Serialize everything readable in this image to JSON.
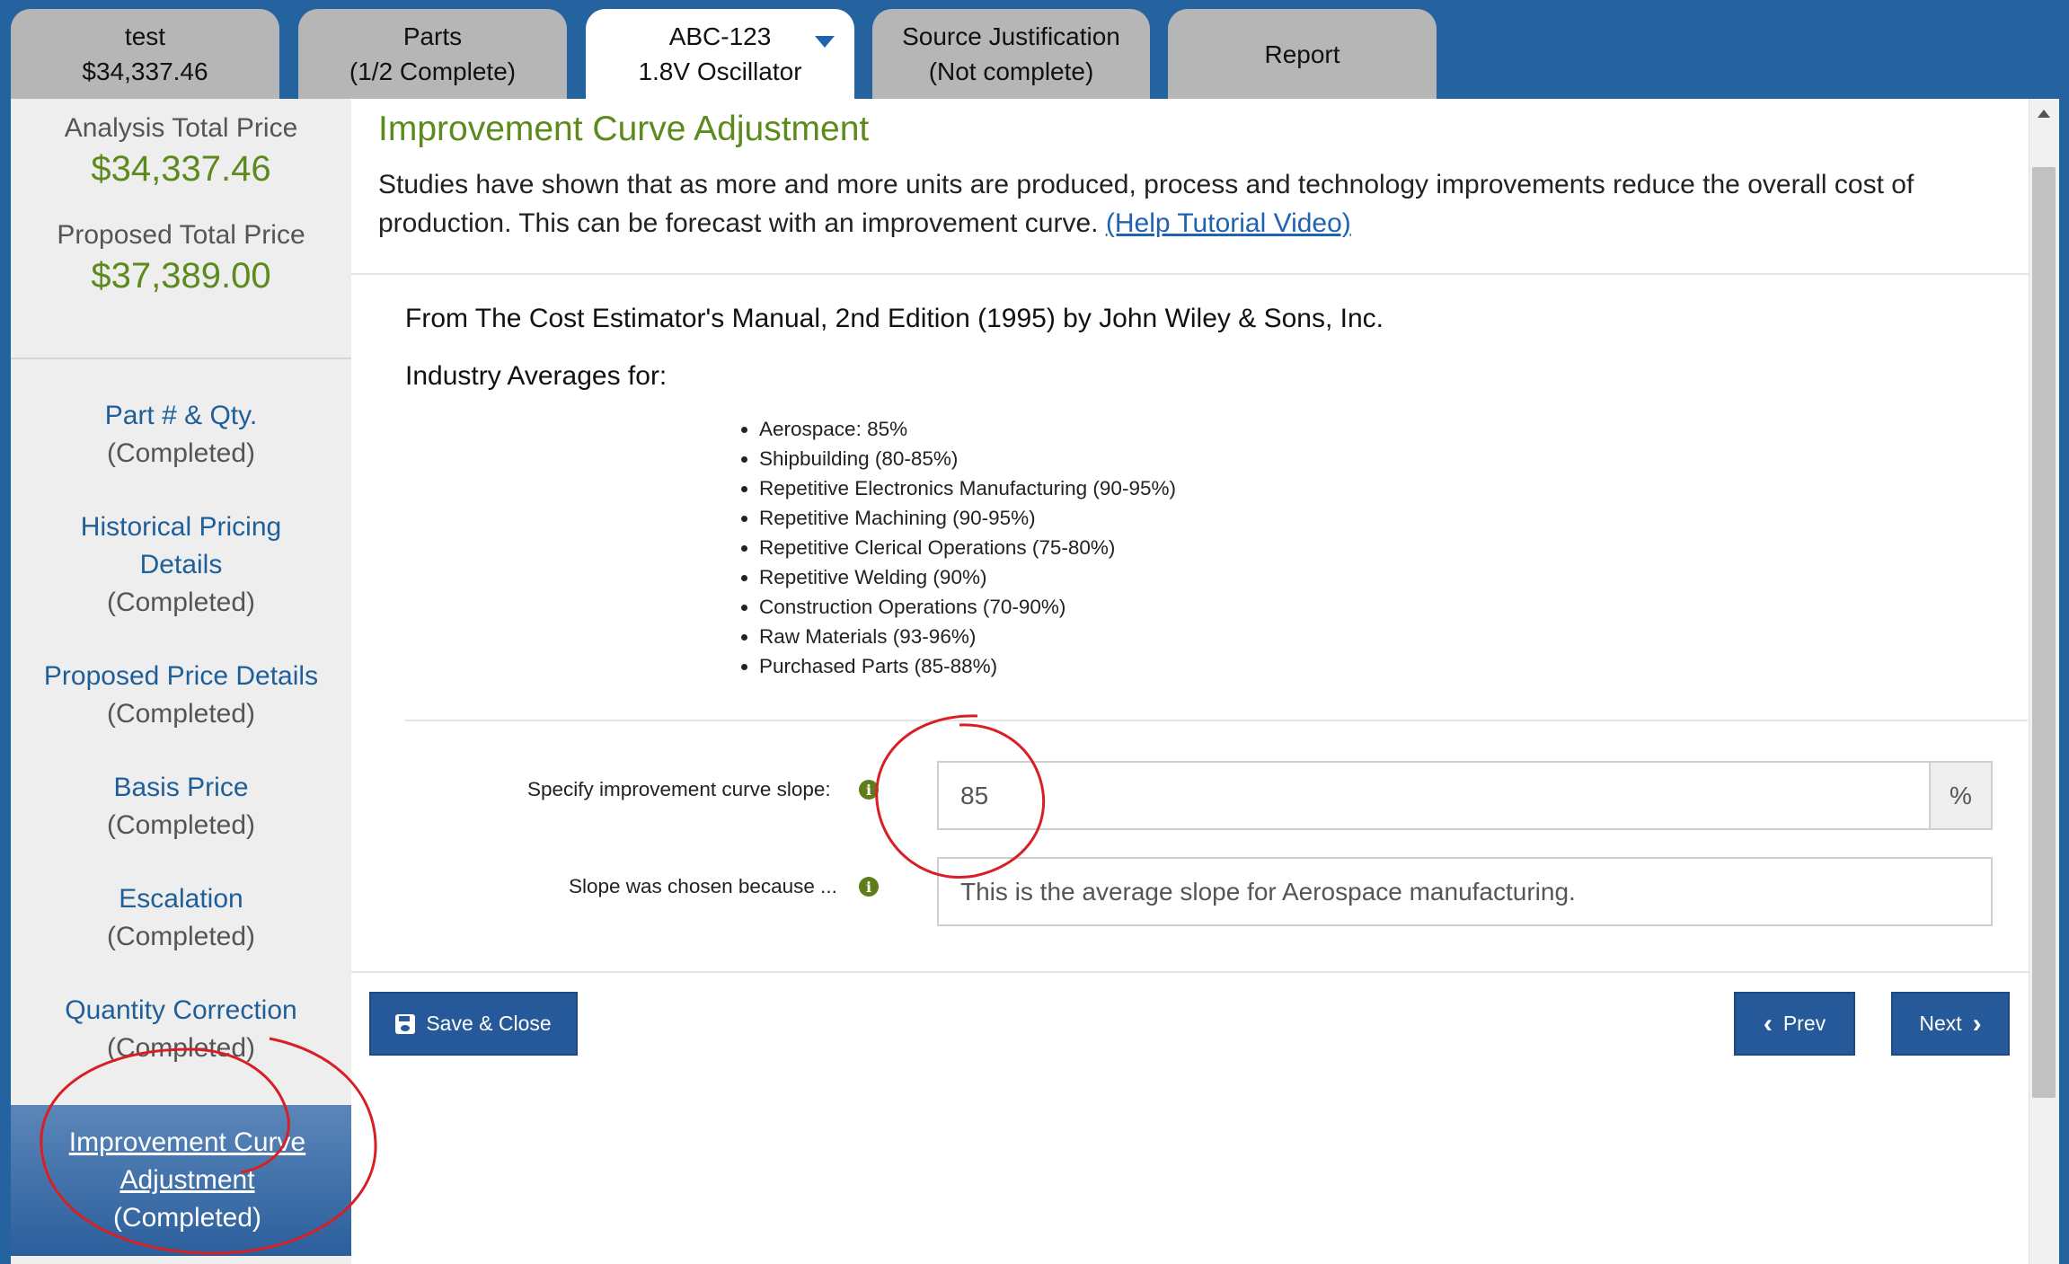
{
  "tabs": [
    {
      "line1": "test",
      "line2": "$34,337.46"
    },
    {
      "line1": "Parts",
      "line2": "(1/2 Complete)"
    },
    {
      "line1": "ABC-123",
      "line2": "1.8V Oscillator"
    },
    {
      "line1": "Source Justification",
      "line2": "(Not complete)"
    },
    {
      "line1": "Report",
      "line2": ""
    }
  ],
  "sidebar": {
    "analysis_label": "Analysis Total Price",
    "analysis_value": "$34,337.46",
    "proposed_label": "Proposed Total Price",
    "proposed_value": "$37,389.00",
    "items": [
      {
        "title": "Part # & Qty.",
        "status": "(Completed)"
      },
      {
        "title_1": "Historical Pricing",
        "title_2": "Details",
        "status": "(Completed)"
      },
      {
        "title": "Proposed Price Details",
        "status": "(Completed)"
      },
      {
        "title": "Basis Price",
        "status": "(Completed)"
      },
      {
        "title": "Escalation",
        "status": "(Completed)"
      },
      {
        "title": "Quantity Correction",
        "status": "(Completed)"
      },
      {
        "title_1": "Improvement Curve",
        "title_2": "Adjustment",
        "status": "(Completed)"
      }
    ]
  },
  "main": {
    "title": "Improvement Curve Adjustment",
    "intro": "Studies have shown that as more and more units are produced, process and technology improvements reduce the overall cost of production. This can be forecast with an improvement curve.",
    "help_link": "(Help Tutorial Video)",
    "source": "From The Cost Estimator's Manual, 2nd Edition (1995) by John Wiley & Sons, Inc.",
    "averages_heading": "Industry Averages for:",
    "averages": [
      "Aerospace: 85%",
      "Shipbuilding (80-85%)",
      "Repetitive Electronics Manufacturing (90-95%)",
      "Repetitive Machining (90-95%)",
      "Repetitive Clerical Operations (75-80%)",
      "Repetitive Welding (90%)",
      "Construction Operations (70-90%)",
      "Raw Materials (93-96%)",
      "Purchased Parts (85-88%)"
    ],
    "slope_label": "Specify improvement curve slope:",
    "slope_value": "85",
    "slope_unit": "%",
    "reason_label": "Slope was chosen because ...",
    "reason_value": "This is the average slope for Aerospace manufacturing.",
    "info_glyph": "i"
  },
  "buttons": {
    "save_close": "Save & Close",
    "prev": "Prev",
    "next": "Next",
    "prev_glyph": "‹",
    "next_glyph": "›"
  },
  "colors": {
    "header_blue": "#2462a0",
    "title_green": "#5c8a1d",
    "link_blue": "#1f63b0",
    "annotation_red": "#d81f26"
  }
}
